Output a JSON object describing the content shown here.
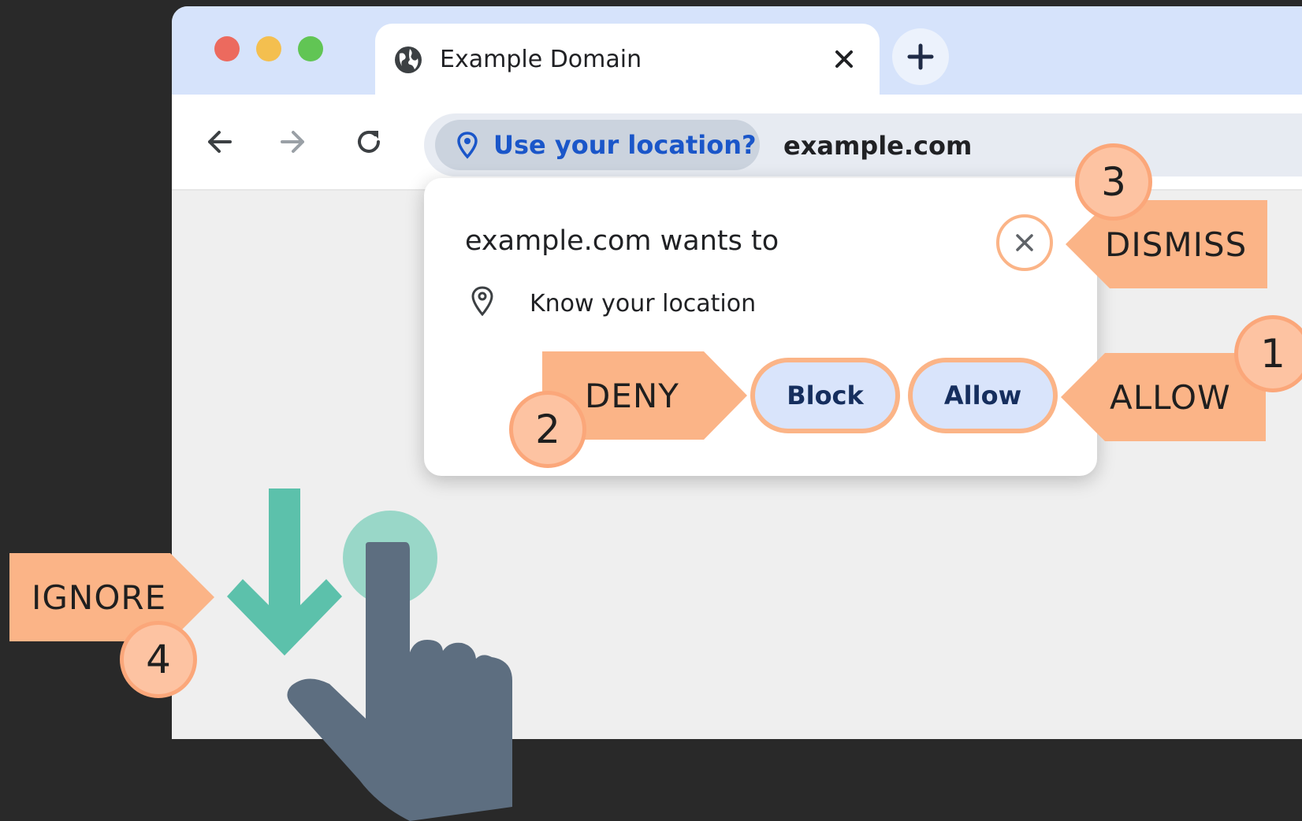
{
  "browser": {
    "tab": {
      "title": "Example Domain"
    },
    "address": {
      "chip_label": "Use your location?",
      "url": "example.com"
    }
  },
  "permission_prompt": {
    "title": "example.com wants to",
    "permission": "Know your location",
    "block_label": "Block",
    "allow_label": "Allow"
  },
  "annotations": {
    "allow": {
      "number": "1",
      "label": "ALLOW"
    },
    "deny": {
      "number": "2",
      "label": "DENY"
    },
    "dismiss": {
      "number": "3",
      "label": "DISMISS"
    },
    "ignore": {
      "number": "4",
      "label": "IGNORE"
    }
  },
  "colors": {
    "callout_fill": "#fbb487",
    "badge_fill": "#fdc3a2",
    "arrow": "#5cc1ab",
    "hand": "#5d6e80",
    "link_blue": "#1a56c9"
  },
  "icons": [
    "globe-icon",
    "close-icon",
    "plus-icon",
    "back-arrow-icon",
    "forward-arrow-icon",
    "reload-icon",
    "location-pin-icon",
    "down-arrow-icon",
    "pointing-hand-icon"
  ]
}
